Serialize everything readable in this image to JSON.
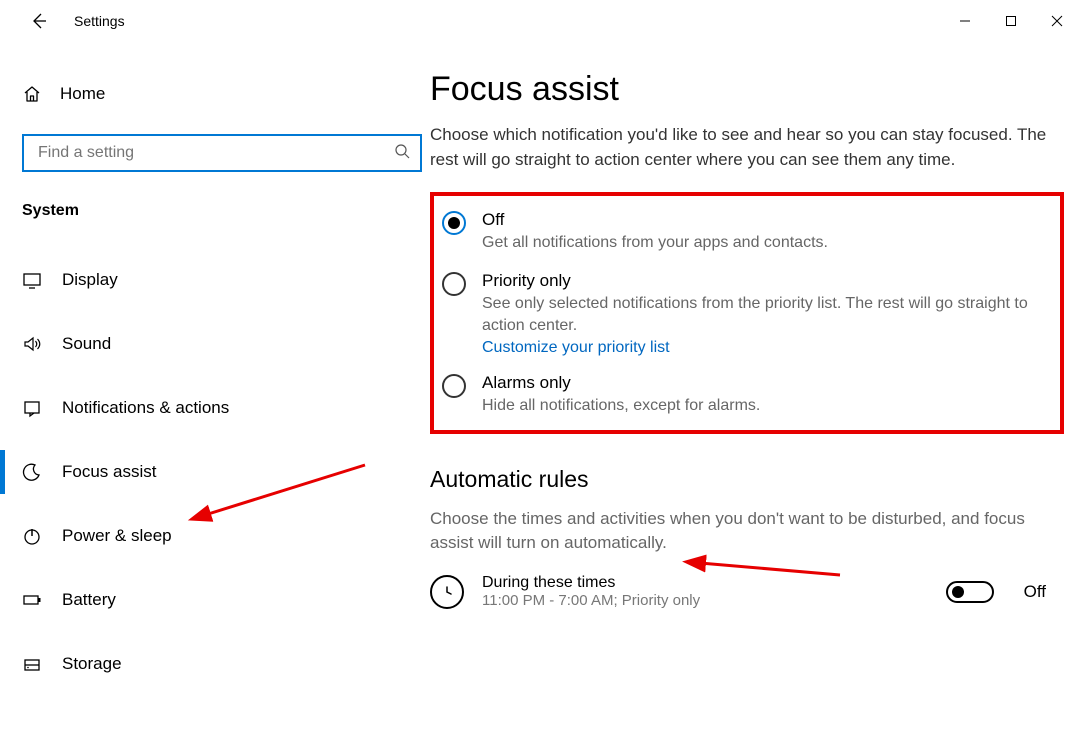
{
  "window": {
    "title": "Settings"
  },
  "sidebar": {
    "home_label": "Home",
    "search_placeholder": "Find a setting",
    "category": "System",
    "items": [
      {
        "label": "Display"
      },
      {
        "label": "Sound"
      },
      {
        "label": "Notifications & actions"
      },
      {
        "label": "Focus assist"
      },
      {
        "label": "Power & sleep"
      },
      {
        "label": "Battery"
      },
      {
        "label": "Storage"
      }
    ]
  },
  "page": {
    "title": "Focus assist",
    "description": "Choose which notification you'd like to see and hear so you can stay focused. The rest will go straight to action center where you can see them any time.",
    "options": {
      "off": {
        "label": "Off",
        "desc": "Get all notifications from your apps and contacts."
      },
      "priority": {
        "label": "Priority only",
        "desc": "See only selected notifications from the priority list. The rest will go straight to action center.",
        "link": "Customize your priority list"
      },
      "alarms": {
        "label": "Alarms only",
        "desc": "Hide all notifications, except for alarms."
      }
    },
    "automatic": {
      "title": "Automatic rules",
      "desc": "Choose the times and activities when you don't want to be disturbed, and focus assist will turn on automatically.",
      "rule1": {
        "title": "During these times",
        "sub": "11:00 PM - 7:00 AM; Priority only",
        "state": "Off"
      }
    }
  }
}
